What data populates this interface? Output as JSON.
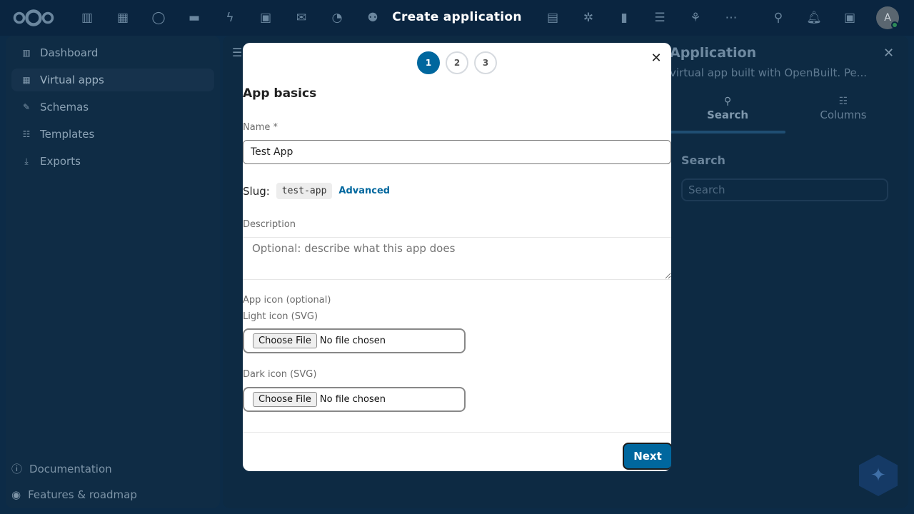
{
  "background": {
    "nav": {
      "items": [
        {
          "label": "Dashboard",
          "icon": "dashboard-icon"
        },
        {
          "label": "Virtual apps",
          "icon": "virtual-apps-icon"
        },
        {
          "label": "Schemas",
          "icon": "wrench-icon"
        },
        {
          "label": "Templates",
          "icon": "checklist-icon"
        },
        {
          "label": "Exports",
          "icon": "download-icon"
        }
      ],
      "active_item": "Virtual apps",
      "footer": [
        {
          "label": "Documentation",
          "icon": "info-icon"
        },
        {
          "label": "Features & roadmap",
          "icon": "eye-icon"
        }
      ]
    },
    "sidebar": {
      "title": "Application",
      "subtitle": "virtual app built with OpenBuilt. Pe...",
      "tabs": [
        {
          "label": "Search",
          "icon": "search-icon"
        },
        {
          "label": "Columns",
          "icon": "columns-icon"
        }
      ],
      "search_label": "Search",
      "search_placeholder": "Search"
    }
  },
  "modal": {
    "heading": "Create application",
    "steps": [
      "1",
      "2",
      "3"
    ],
    "active_step": "1",
    "section_title": "App basics",
    "name_label": "Name *",
    "name_value": "Test App",
    "slug_label": "Slug:",
    "slug_value": "test-app",
    "advanced_label": "Advanced",
    "description_label": "Description",
    "description_placeholder": "Optional: describe what this app does",
    "app_icon_label": "App icon (optional)",
    "light_icon_label": "Light icon (SVG)",
    "dark_icon_label": "Dark icon (SVG)",
    "choose_file_label": "Choose File",
    "no_file_label": "No file chosen",
    "next_label": "Next"
  },
  "colors": {
    "accent": "#00679e",
    "backdrop": "#0c2b47"
  }
}
